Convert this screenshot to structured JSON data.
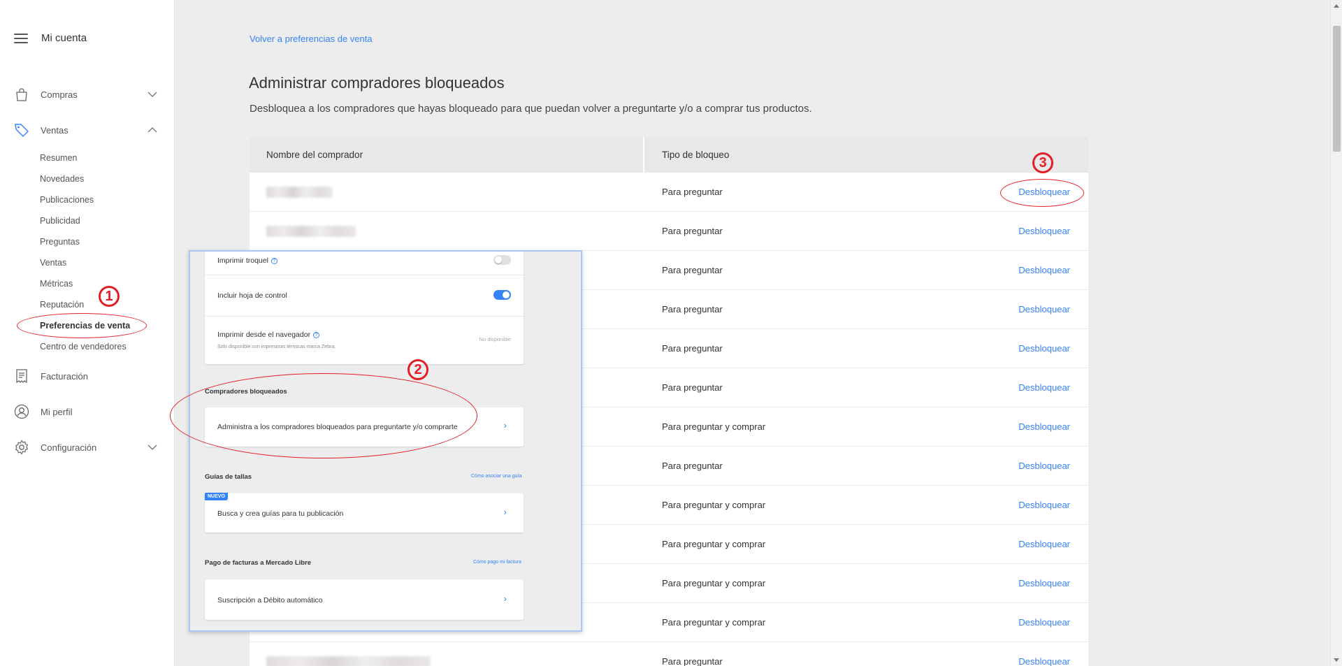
{
  "sidebar": {
    "title": "Mi cuenta",
    "items": {
      "compras": "Compras",
      "ventas": "Ventas",
      "facturacion": "Facturación",
      "perfil": "Mi perfil",
      "configuracion": "Configuración"
    },
    "ventas_sub": [
      "Resumen",
      "Novedades",
      "Publicaciones",
      "Publicidad",
      "Preguntas",
      "Ventas",
      "Métricas",
      "Reputación",
      "Preferencias de venta",
      "Centro de vendedores"
    ],
    "active_sub": "Preferencias de venta"
  },
  "main": {
    "back_link": "Volver a preferencias de venta",
    "title": "Administrar compradores bloqueados",
    "description": "Desbloquea a los compradores que hayas bloqueado para que puedan volver a preguntarte y/o a comprar tus productos.",
    "table": {
      "headers": [
        "Nombre del comprador",
        "Tipo de bloqueo"
      ],
      "action_label": "Desbloquear",
      "rows": [
        {
          "type": "Para preguntar"
        },
        {
          "type": "Para preguntar"
        },
        {
          "type": "Para preguntar"
        },
        {
          "type": "Para preguntar"
        },
        {
          "type": "Para preguntar"
        },
        {
          "type": "Para preguntar"
        },
        {
          "type": "Para preguntar y comprar"
        },
        {
          "type": "Para preguntar"
        },
        {
          "type": "Para preguntar y comprar"
        },
        {
          "type": "Para preguntar y comprar"
        },
        {
          "type": "Para preguntar y comprar"
        },
        {
          "type": "Para preguntar y comprar"
        },
        {
          "type": "Para preguntar"
        }
      ]
    }
  },
  "overlay": {
    "rows": {
      "troquel": "Imprimir troquel",
      "hoja_control": "Incluir hoja de control",
      "navegador": "Imprimir desde el navegador",
      "navegador_note": "Solo disponible con impresoras térmicas marca Zebra.",
      "navegador_status": "No disponible"
    },
    "sections": {
      "bloqueados_title": "Compradores bloqueados",
      "bloqueados_item": "Administra a los compradores bloqueados para preguntarte y/o comprarte",
      "tallas_title": "Guías de tallas",
      "tallas_link": "Cómo asociar una guía",
      "tallas_badge": "NUEVO",
      "tallas_item": "Busca y crea guías para tu publicación",
      "facturas_title": "Pago de facturas a Mercado Libre",
      "facturas_link": "Cómo pago mi factura",
      "facturas_item": "Suscripción a Débito automático"
    },
    "toggles": {
      "troquel": false,
      "hoja_control": true
    }
  },
  "annotations": {
    "step1": "1",
    "step2": "2",
    "step3": "3",
    "color": "#e41e26"
  },
  "colors": {
    "accent": "#3483fa",
    "background": "#ededed"
  }
}
